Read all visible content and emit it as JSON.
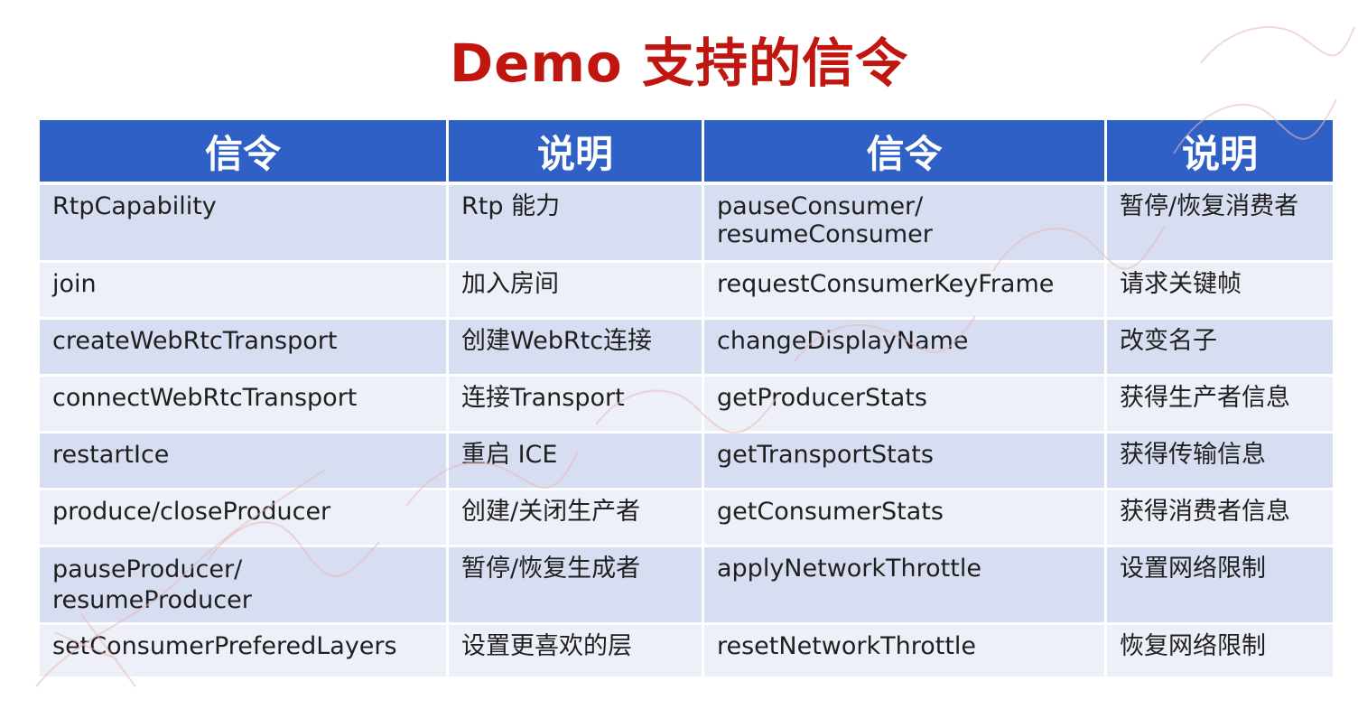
{
  "title": "Demo 支持的信令",
  "table": {
    "headers": [
      "信令",
      "说明",
      "信令",
      "说明"
    ],
    "rows": [
      [
        "RtpCapability",
        "Rtp 能力",
        "pauseConsumer/\nresumeConsumer",
        "暂停/恢复消费者"
      ],
      [
        "join",
        "加入房间",
        "requestConsumerKeyFrame",
        "请求关键帧"
      ],
      [
        "createWebRtcTransport",
        "创建WebRtc连接",
        "changeDisplayName",
        "改变名子"
      ],
      [
        "connectWebRtcTransport",
        "连接Transport",
        "getProducerStats",
        "获得生产者信息"
      ],
      [
        "restartIce",
        "重启 ICE",
        "getTransportStats",
        "获得传输信息"
      ],
      [
        "produce/closeProducer",
        "创建/关闭生产者",
        "getConsumerStats",
        "获得消费者信息"
      ],
      [
        "pauseProducer/\nresumeProducer",
        "暂停/恢复生成者",
        "applyNetworkThrottle",
        "设置网络限制"
      ],
      [
        "setConsumerPreferedLayers",
        "设置更喜欢的层",
        "resetNetworkThrottle",
        "恢复网络限制"
      ]
    ]
  },
  "colors": {
    "title": "#c0160f",
    "header_bg": "#2f60c6",
    "row_dark": "#d7def1",
    "row_light": "#edf0f8"
  }
}
